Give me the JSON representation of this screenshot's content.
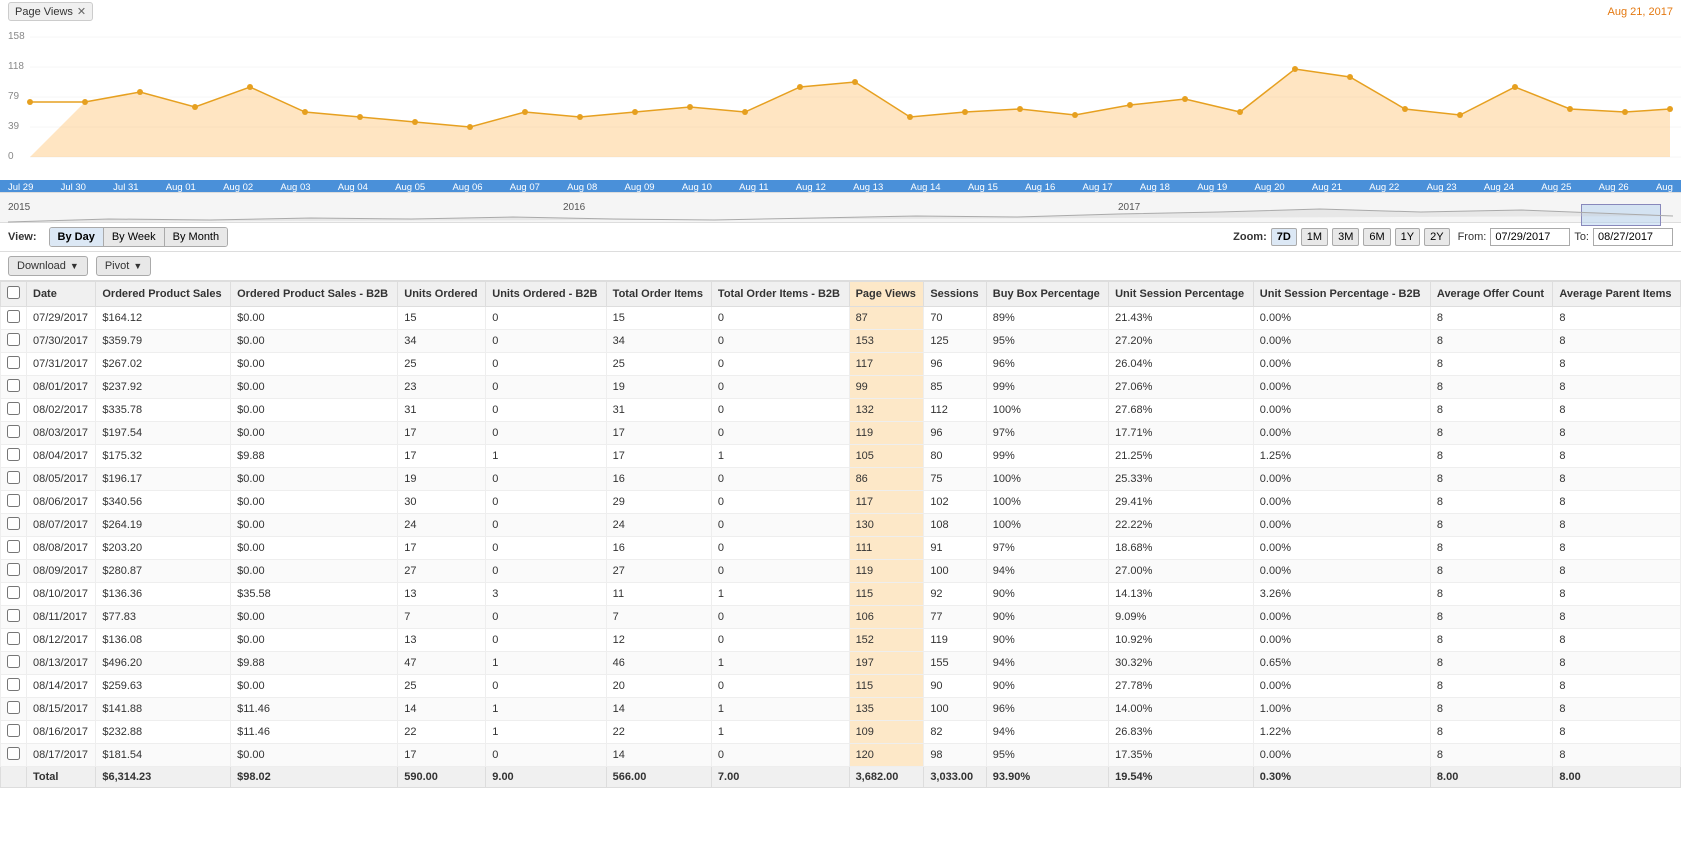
{
  "topBar": {
    "tag": "Page Views",
    "date": "Aug 21, 2017"
  },
  "chart": {
    "yLabels": [
      "158",
      "118",
      "79",
      "39",
      "0"
    ],
    "xLabels": [
      "Jul 29",
      "Jul 30",
      "Jul 31",
      "Aug 01",
      "Aug 02",
      "Aug 03",
      "Aug 04",
      "Aug 05",
      "Aug 06",
      "Aug 07",
      "Aug 08",
      "Aug 09",
      "Aug 10",
      "Aug 11",
      "Aug 12",
      "Aug 13",
      "Aug 14",
      "Aug 15",
      "Aug 16",
      "Aug 17",
      "Aug 18",
      "Aug 19",
      "Aug 20",
      "Aug 21",
      "Aug 22",
      "Aug 23",
      "Aug 24",
      "Aug 25",
      "Aug 26",
      "Aug"
    ]
  },
  "navigator": {
    "years": [
      "2015",
      "2016",
      "2017"
    ]
  },
  "controls": {
    "viewLabel": "View:",
    "viewButtons": [
      "By Day",
      "By Week",
      "By Month"
    ],
    "activeView": "By Day",
    "zoomLabel": "Zoom:",
    "zoomButtons": [
      "7D",
      "1M",
      "3M",
      "6M",
      "1Y",
      "2Y"
    ],
    "activeZoom": "7D",
    "fromLabel": "From:",
    "fromDate": "07/29/2017",
    "toLabel": "To:",
    "toDate": "08/27/2017"
  },
  "toolbar": {
    "downloadLabel": "Download",
    "pivotLabel": "Pivot"
  },
  "table": {
    "columns": [
      {
        "id": "checkbox",
        "label": ""
      },
      {
        "id": "date",
        "label": "Date"
      },
      {
        "id": "ordered_product_sales",
        "label": "Ordered Product Sales"
      },
      {
        "id": "ordered_product_sales_b2b",
        "label": "Ordered Product Sales - B2B"
      },
      {
        "id": "units_ordered",
        "label": "Units Ordered"
      },
      {
        "id": "units_ordered_b2b",
        "label": "Units Ordered - B2B"
      },
      {
        "id": "total_order_items",
        "label": "Total Order Items"
      },
      {
        "id": "total_order_items_b2b",
        "label": "Total Order Items - B2B"
      },
      {
        "id": "page_views",
        "label": "Page Views"
      },
      {
        "id": "sessions",
        "label": "Sessions"
      },
      {
        "id": "buy_box_percentage",
        "label": "Buy Box Percentage"
      },
      {
        "id": "unit_session_percentage",
        "label": "Unit Session Percentage"
      },
      {
        "id": "unit_session_percentage_b2b",
        "label": "Unit Session Percentage - B2B"
      },
      {
        "id": "average_offer_count",
        "label": "Average Offer Count"
      },
      {
        "id": "average_parent_items",
        "label": "Average Parent Items"
      }
    ],
    "rows": [
      {
        "date": "07/29/2017",
        "ops": "$164.12",
        "ops_b2b": "$0.00",
        "uo": "15",
        "uo_b2b": "0",
        "toi": "15",
        "toi_b2b": "0",
        "pv": "87",
        "sessions": "70",
        "bbp": "89%",
        "usp": "21.43%",
        "usp_b2b": "0.00%",
        "aoc": "8",
        "api": "8"
      },
      {
        "date": "07/30/2017",
        "ops": "$359.79",
        "ops_b2b": "$0.00",
        "uo": "34",
        "uo_b2b": "0",
        "toi": "34",
        "toi_b2b": "0",
        "pv": "153",
        "sessions": "125",
        "bbp": "95%",
        "usp": "27.20%",
        "usp_b2b": "0.00%",
        "aoc": "8",
        "api": "8"
      },
      {
        "date": "07/31/2017",
        "ops": "$267.02",
        "ops_b2b": "$0.00",
        "uo": "25",
        "uo_b2b": "0",
        "toi": "25",
        "toi_b2b": "0",
        "pv": "117",
        "sessions": "96",
        "bbp": "96%",
        "usp": "26.04%",
        "usp_b2b": "0.00%",
        "aoc": "8",
        "api": "8"
      },
      {
        "date": "08/01/2017",
        "ops": "$237.92",
        "ops_b2b": "$0.00",
        "uo": "23",
        "uo_b2b": "0",
        "toi": "19",
        "toi_b2b": "0",
        "pv": "99",
        "sessions": "85",
        "bbp": "99%",
        "usp": "27.06%",
        "usp_b2b": "0.00%",
        "aoc": "8",
        "api": "8"
      },
      {
        "date": "08/02/2017",
        "ops": "$335.78",
        "ops_b2b": "$0.00",
        "uo": "31",
        "uo_b2b": "0",
        "toi": "31",
        "toi_b2b": "0",
        "pv": "132",
        "sessions": "112",
        "bbp": "100%",
        "usp": "27.68%",
        "usp_b2b": "0.00%",
        "aoc": "8",
        "api": "8"
      },
      {
        "date": "08/03/2017",
        "ops": "$197.54",
        "ops_b2b": "$0.00",
        "uo": "17",
        "uo_b2b": "0",
        "toi": "17",
        "toi_b2b": "0",
        "pv": "119",
        "sessions": "96",
        "bbp": "97%",
        "usp": "17.71%",
        "usp_b2b": "0.00%",
        "aoc": "8",
        "api": "8"
      },
      {
        "date": "08/04/2017",
        "ops": "$175.32",
        "ops_b2b": "$9.88",
        "uo": "17",
        "uo_b2b": "1",
        "toi": "17",
        "toi_b2b": "1",
        "pv": "105",
        "sessions": "80",
        "bbp": "99%",
        "usp": "21.25%",
        "usp_b2b": "1.25%",
        "aoc": "8",
        "api": "8"
      },
      {
        "date": "08/05/2017",
        "ops": "$196.17",
        "ops_b2b": "$0.00",
        "uo": "19",
        "uo_b2b": "0",
        "toi": "16",
        "toi_b2b": "0",
        "pv": "86",
        "sessions": "75",
        "bbp": "100%",
        "usp": "25.33%",
        "usp_b2b": "0.00%",
        "aoc": "8",
        "api": "8"
      },
      {
        "date": "08/06/2017",
        "ops": "$340.56",
        "ops_b2b": "$0.00",
        "uo": "30",
        "uo_b2b": "0",
        "toi": "29",
        "toi_b2b": "0",
        "pv": "117",
        "sessions": "102",
        "bbp": "100%",
        "usp": "29.41%",
        "usp_b2b": "0.00%",
        "aoc": "8",
        "api": "8"
      },
      {
        "date": "08/07/2017",
        "ops": "$264.19",
        "ops_b2b": "$0.00",
        "uo": "24",
        "uo_b2b": "0",
        "toi": "24",
        "toi_b2b": "0",
        "pv": "130",
        "sessions": "108",
        "bbp": "100%",
        "usp": "22.22%",
        "usp_b2b": "0.00%",
        "aoc": "8",
        "api": "8"
      },
      {
        "date": "08/08/2017",
        "ops": "$203.20",
        "ops_b2b": "$0.00",
        "uo": "17",
        "uo_b2b": "0",
        "toi": "16",
        "toi_b2b": "0",
        "pv": "111",
        "sessions": "91",
        "bbp": "97%",
        "usp": "18.68%",
        "usp_b2b": "0.00%",
        "aoc": "8",
        "api": "8"
      },
      {
        "date": "08/09/2017",
        "ops": "$280.87",
        "ops_b2b": "$0.00",
        "uo": "27",
        "uo_b2b": "0",
        "toi": "27",
        "toi_b2b": "0",
        "pv": "119",
        "sessions": "100",
        "bbp": "94%",
        "usp": "27.00%",
        "usp_b2b": "0.00%",
        "aoc": "8",
        "api": "8"
      },
      {
        "date": "08/10/2017",
        "ops": "$136.36",
        "ops_b2b": "$35.58",
        "uo": "13",
        "uo_b2b": "3",
        "toi": "11",
        "toi_b2b": "1",
        "pv": "115",
        "sessions": "92",
        "bbp": "90%",
        "usp": "14.13%",
        "usp_b2b": "3.26%",
        "aoc": "8",
        "api": "8"
      },
      {
        "date": "08/11/2017",
        "ops": "$77.83",
        "ops_b2b": "$0.00",
        "uo": "7",
        "uo_b2b": "0",
        "toi": "7",
        "toi_b2b": "0",
        "pv": "106",
        "sessions": "77",
        "bbp": "90%",
        "usp": "9.09%",
        "usp_b2b": "0.00%",
        "aoc": "8",
        "api": "8"
      },
      {
        "date": "08/12/2017",
        "ops": "$136.08",
        "ops_b2b": "$0.00",
        "uo": "13",
        "uo_b2b": "0",
        "toi": "12",
        "toi_b2b": "0",
        "pv": "152",
        "sessions": "119",
        "bbp": "90%",
        "usp": "10.92%",
        "usp_b2b": "0.00%",
        "aoc": "8",
        "api": "8"
      },
      {
        "date": "08/13/2017",
        "ops": "$496.20",
        "ops_b2b": "$9.88",
        "uo": "47",
        "uo_b2b": "1",
        "toi": "46",
        "toi_b2b": "1",
        "pv": "197",
        "sessions": "155",
        "bbp": "94%",
        "usp": "30.32%",
        "usp_b2b": "0.65%",
        "aoc": "8",
        "api": "8"
      },
      {
        "date": "08/14/2017",
        "ops": "$259.63",
        "ops_b2b": "$0.00",
        "uo": "25",
        "uo_b2b": "0",
        "toi": "20",
        "toi_b2b": "0",
        "pv": "115",
        "sessions": "90",
        "bbp": "90%",
        "usp": "27.78%",
        "usp_b2b": "0.00%",
        "aoc": "8",
        "api": "8"
      },
      {
        "date": "08/15/2017",
        "ops": "$141.88",
        "ops_b2b": "$11.46",
        "uo": "14",
        "uo_b2b": "1",
        "toi": "14",
        "toi_b2b": "1",
        "pv": "135",
        "sessions": "100",
        "bbp": "96%",
        "usp": "14.00%",
        "usp_b2b": "1.00%",
        "aoc": "8",
        "api": "8"
      },
      {
        "date": "08/16/2017",
        "ops": "$232.88",
        "ops_b2b": "$11.46",
        "uo": "22",
        "uo_b2b": "1",
        "toi": "22",
        "toi_b2b": "1",
        "pv": "109",
        "sessions": "82",
        "bbp": "94%",
        "usp": "26.83%",
        "usp_b2b": "1.22%",
        "aoc": "8",
        "api": "8"
      },
      {
        "date": "08/17/2017",
        "ops": "$181.54",
        "ops_b2b": "$0.00",
        "uo": "17",
        "uo_b2b": "0",
        "toi": "14",
        "toi_b2b": "0",
        "pv": "120",
        "sessions": "98",
        "bbp": "95%",
        "usp": "17.35%",
        "usp_b2b": "0.00%",
        "aoc": "8",
        "api": "8"
      }
    ],
    "totals": {
      "label": "Total",
      "ops": "$6,314.23",
      "ops_b2b": "$98.02",
      "uo": "590.00",
      "uo_b2b": "9.00",
      "toi": "566.00",
      "toi_b2b": "7.00",
      "pv": "3,682.00",
      "sessions": "3,033.00",
      "bbp": "93.90%",
      "usp": "19.54%",
      "usp_b2b": "0.30%",
      "aoc": "8.00",
      "api": "8.00"
    }
  }
}
